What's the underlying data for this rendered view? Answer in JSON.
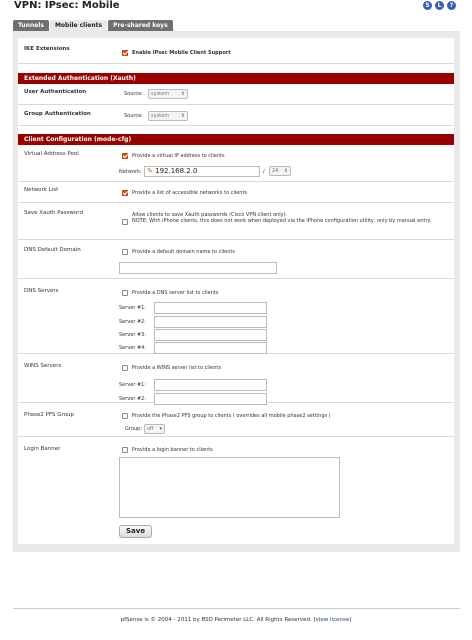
{
  "header": {
    "title": "VPN: IPsec: Mobile",
    "icons": [
      "S",
      "L",
      "?"
    ]
  },
  "tabs": [
    {
      "label": "Tunnels",
      "active": false
    },
    {
      "label": "Mobile clients",
      "active": true
    },
    {
      "label": "Pre-shared keys",
      "active": false
    }
  ],
  "ike": {
    "label": "IKE Extensions",
    "checkbox_label": "Enable IPsec Mobile Client Support",
    "checked": true
  },
  "xauth": {
    "section_title": "Extended Authentication (Xauth)",
    "user_auth_label": "User Authentication",
    "user_source_label": "Source:",
    "user_source_value": "system",
    "group_auth_label": "Group Authentication",
    "group_source_label": "Source:",
    "group_source_value": "system"
  },
  "client_config": {
    "section_title": "Client Configuration (mode-cfg)",
    "vap": {
      "label": "Virtual Address Pool",
      "checkbox_label": "Provide a virtual IP address to clients",
      "network_label": "Network:",
      "network_value": "192.168.2.0",
      "slash": "/",
      "mask_value": "24"
    },
    "network_list": {
      "label": "Network List",
      "checkbox_label": "Provide a list of accessible networks to clients"
    },
    "save_xauth": {
      "label": "Save Xauth Password",
      "text_line1": "Allow clients to save Xauth passwords (Cisco VPN client only).",
      "text_line2": "NOTE: With iPhone clients, this does not work when deployed via the iPhone configuration utility, only by manual entry."
    },
    "dns_domain": {
      "label": "DNS Default Domain",
      "checkbox_label": "Provide a default domain name to clients",
      "value": ""
    },
    "dns_servers": {
      "label": "DNS Servers",
      "checkbox_label": "Provide a DNS server list to clients",
      "servers": [
        "Server #1:",
        "Server #2:",
        "Server #3:",
        "Server #4:"
      ]
    },
    "wins_servers": {
      "label": "WINS Servers",
      "checkbox_label": "Provide a WINS server list to clients",
      "servers": [
        "Server #1:",
        "Server #2:"
      ]
    },
    "pfs": {
      "label": "Phase2 PFS Group",
      "checkbox_label": "Provide the Phase2 PFS group to clients ( overrides all mobile phase2 settings )",
      "group_label": "Group:",
      "group_value": "off"
    },
    "banner": {
      "label": "Login Banner",
      "checkbox_label": "Provide a login banner to clients"
    }
  },
  "save_button": "Save",
  "footer": {
    "text": "pfSense is © 2004 - 2011 by BSD Perimeter LLC. All Rights Reserved. [",
    "link": "view license",
    "end": "]"
  }
}
